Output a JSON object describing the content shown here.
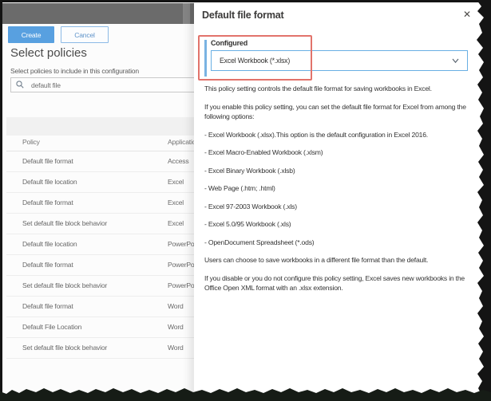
{
  "left_page": {
    "toolbar": {
      "create_label": "Create",
      "cancel_label": "Cancel"
    },
    "heading": "Select policies",
    "subheading": "Select policies to include in this configuration",
    "search": {
      "icon": "search-icon",
      "value": "default file"
    },
    "table": {
      "columns": {
        "policy": "Policy",
        "application": "Application"
      },
      "rows": [
        {
          "policy": "Default file format",
          "application": "Access"
        },
        {
          "policy": "Default file location",
          "application": "Excel"
        },
        {
          "policy": "Default file format",
          "application": "Excel"
        },
        {
          "policy": "Set default file block behavior",
          "application": "Excel"
        },
        {
          "policy": "Default file location",
          "application": "PowerPoint"
        },
        {
          "policy": "Default file format",
          "application": "PowerPoint"
        },
        {
          "policy": "Set default file block behavior",
          "application": "PowerPoint"
        },
        {
          "policy": "Default file format",
          "application": "Word"
        },
        {
          "policy": "Default File Location",
          "application": "Word"
        },
        {
          "policy": "Set default file block behavior",
          "application": "Word"
        }
      ]
    }
  },
  "flyout": {
    "title": "Default file format",
    "close_icon": "✕",
    "setting": {
      "label": "Configured",
      "value": "Excel Workbook (*.xlsx)",
      "chevron_icon": "chevron-down"
    },
    "description": [
      "This policy setting controls the default file format for saving workbooks in Excel.",
      "If you enable this policy setting, you can set the default file format for Excel from among the following options:",
      "- Excel Workbook (.xlsx).This option is the default configuration in Excel 2016.",
      "- Excel Macro-Enabled Workbook (.xlsm)",
      "- Excel Binary Workbook (.xlsb)",
      "- Web Page (.htm; .html)",
      "- Excel 97-2003 Workbook (.xls)",
      "- Excel 5.0/95 Workbook (.xls)",
      "- OpenDocument Spreadsheet (*.ods)",
      "Users can choose to save workbooks in a different file format than the default.",
      "If you disable or you do not configure this policy setting, Excel saves new workbooks in the Office Open XML format with an .xlsx extension."
    ]
  },
  "colors": {
    "primary_button_blue": "#58a0e0",
    "dropdown_border_blue": "#69afe4",
    "configured_accent_blue": "#79b3e2",
    "annotation_highlight_red": "#e2736b",
    "top_band_gray": "#6b6b6b",
    "torn_edge_black": "#161c16"
  }
}
